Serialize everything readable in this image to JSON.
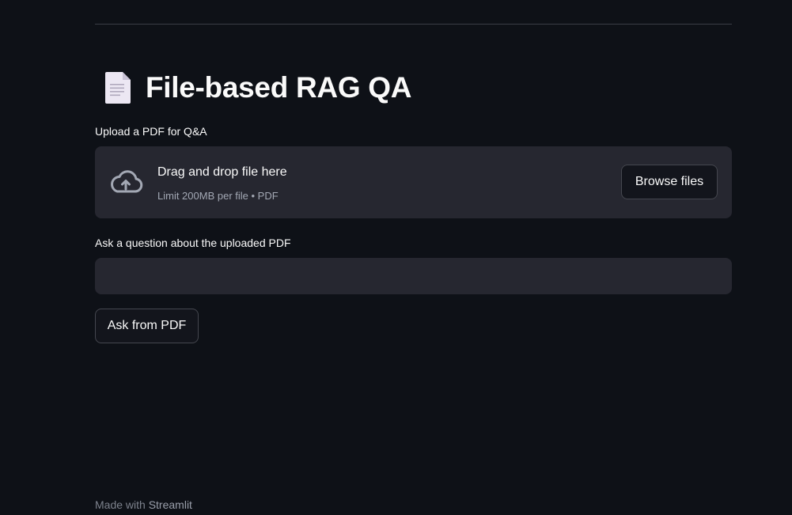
{
  "header": {
    "title": "File-based RAG QA",
    "title_icon": "page-document-icon"
  },
  "upload": {
    "label": "Upload a PDF for Q&A",
    "dropzone_title": "Drag and drop file here",
    "dropzone_subtitle": "Limit 200MB per file • PDF",
    "browse_label": "Browse files",
    "icon": "cloud-upload-icon"
  },
  "question": {
    "label": "Ask a question about the uploaded PDF",
    "value": "",
    "placeholder": ""
  },
  "actions": {
    "ask_label": "Ask from PDF"
  },
  "footer": {
    "prefix": "Made with ",
    "brand": "Streamlit"
  },
  "colors": {
    "background": "#0e1117",
    "surface": "#262730",
    "text": "#fafafa",
    "muted_text": "#a3a8b4",
    "button_border": "#45474f"
  }
}
